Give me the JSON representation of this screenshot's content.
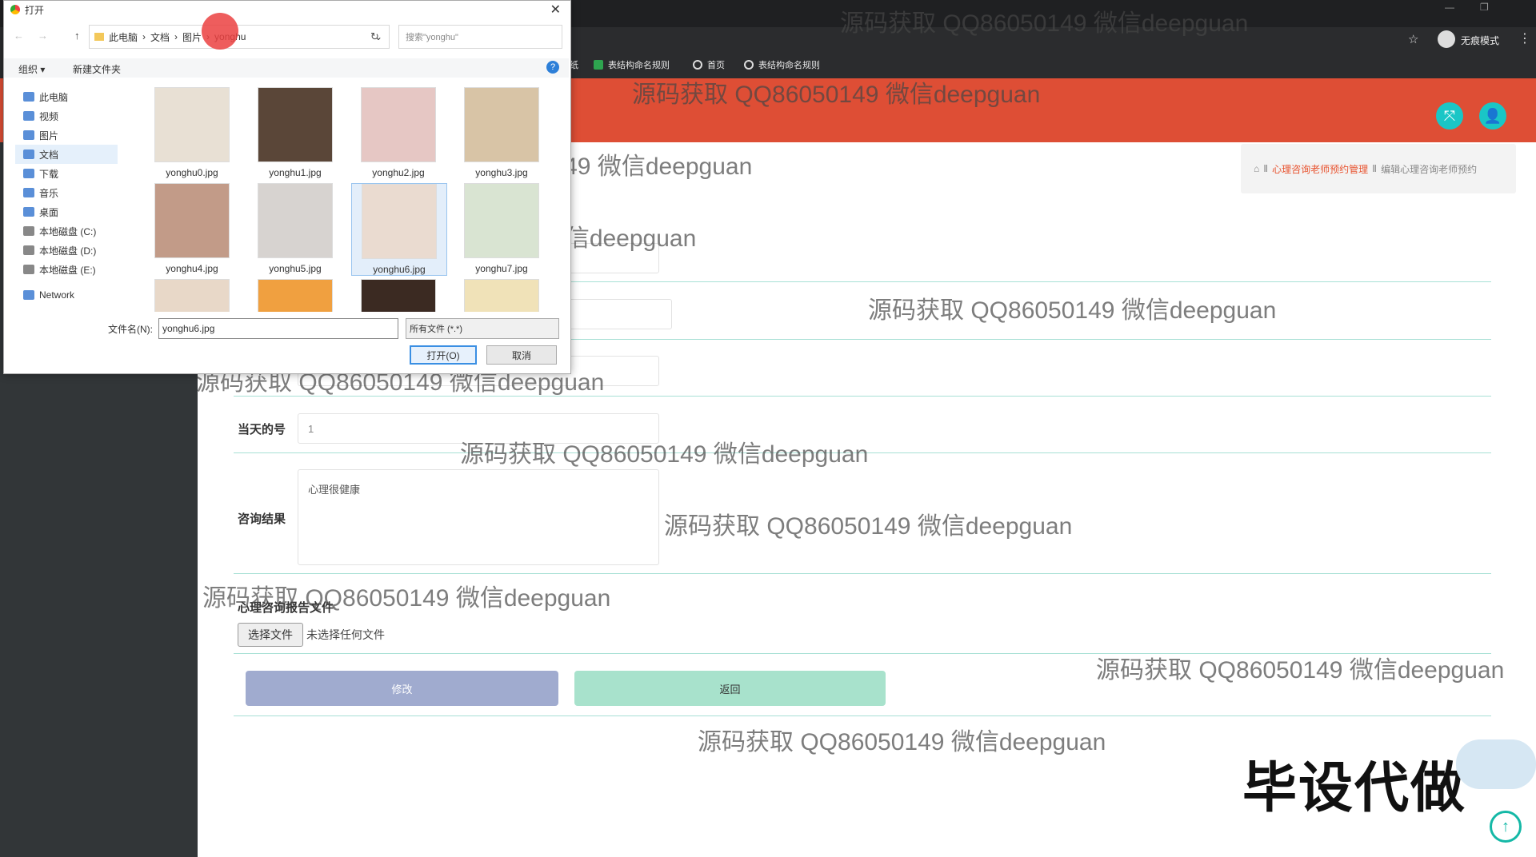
{
  "browser": {
    "incognito_label": "无痕模式",
    "bookmarks": [
      "表结构命名规则",
      "首页",
      "表结构命名规则"
    ],
    "partial_bookmark": "纸"
  },
  "breadcrumb": {
    "sep": "Ⅱ",
    "section": "心理咨询老师预约管理",
    "page": "编辑心理咨询老师预约"
  },
  "form": {
    "day_number_label": "当天的号",
    "day_number_value": "1",
    "result_label": "咨询结果",
    "result_value": "心理很健康",
    "report_label": "心理咨询报告文件",
    "choose_file": "选择文件",
    "no_file": "未选择任何文件",
    "modify_button": "修改",
    "back_button": "返回"
  },
  "watermark": "源码获取 QQ86050149 微信deepguan",
  "promo": "毕设代做",
  "dialog": {
    "title": "打开",
    "path": [
      "此电脑",
      "文档",
      "图片"
    ],
    "current_folder": "yonghu",
    "search_placeholder": "搜索\"yonghu\"",
    "organize": "组织 ▾",
    "new_folder": "新建文件夹",
    "nav": [
      "此电脑",
      "视频",
      "图片",
      "文档",
      "下载",
      "音乐",
      "桌面",
      "本地磁盘 (C:)",
      "本地磁盘 (D:)",
      "本地磁盘 (E:)",
      "Network"
    ],
    "files": [
      "yonghu0.jpg",
      "yonghu1.jpg",
      "yonghu2.jpg",
      "yonghu3.jpg",
      "yonghu4.jpg",
      "yonghu5.jpg",
      "yonghu6.jpg",
      "yonghu7.jpg"
    ],
    "filename_label": "文件名(N):",
    "filename_value": "yonghu6.jpg",
    "filetype": "所有文件 (*.*)",
    "open_button": "打开(O)",
    "cancel_button": "取消"
  }
}
